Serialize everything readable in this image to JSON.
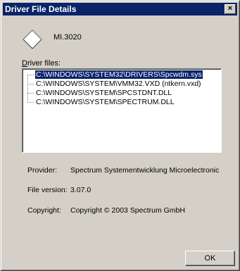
{
  "window": {
    "title": "Driver File Details",
    "close_glyph": "×"
  },
  "device": {
    "icon": "device-diamond-icon",
    "name": "MI.3020"
  },
  "driver_files": {
    "label_accel": "D",
    "label_rest": "river files:",
    "items": [
      {
        "path": "C:\\WINDOWS\\SYSTEM32\\DRIVERS\\Spcwdm.sys",
        "selected": true
      },
      {
        "path": "C:\\WINDOWS\\SYSTEM\\VMM32.VXD (ntkern.vxd)",
        "selected": false
      },
      {
        "path": "C:\\WINDOWS\\SYSTEM\\SPCSTDNT.DLL",
        "selected": false
      },
      {
        "path": "C:\\WINDOWS\\SYSTEM\\SPECTRUM.DLL",
        "selected": false
      }
    ]
  },
  "details": {
    "provider_label": "Provider:",
    "provider_value": "Spectrum Systementwicklung Microelectronic",
    "version_label": "File version:",
    "version_value": "3.07.0",
    "copyright_label": "Copyright:",
    "copyright_value": "Copyright © 2003 Spectrum GmbH"
  },
  "buttons": {
    "ok": "OK"
  },
  "colors": {
    "title_bar": "#0a246a",
    "face": "#d4d0c8",
    "selection": "#0a246a"
  }
}
